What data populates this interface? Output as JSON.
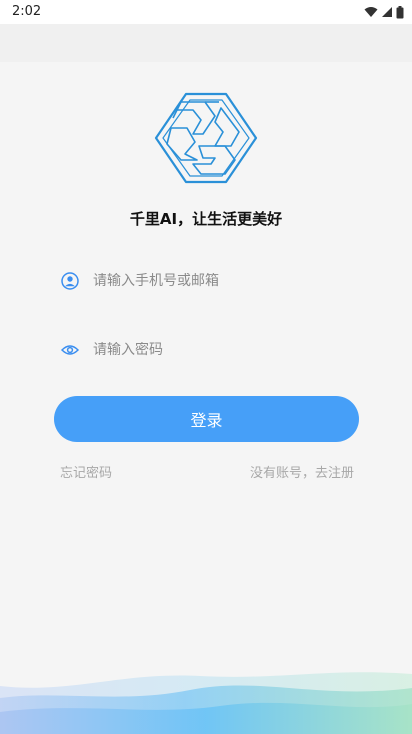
{
  "status_bar": {
    "time": "2:02",
    "icons": [
      "wifi-icon",
      "signal-icon",
      "battery-icon"
    ]
  },
  "brand": {
    "tagline": "千里AI，让生活更美好"
  },
  "form": {
    "account_placeholder": "请输入手机号或邮箱",
    "password_placeholder": "请输入密码",
    "login_label": "登录",
    "forgot_label": "忘记密码",
    "register_label": "没有账号，去注册"
  },
  "colors": {
    "accent": "#469ff8",
    "logo": "#2a90d8",
    "link": "#a8a8a8"
  }
}
